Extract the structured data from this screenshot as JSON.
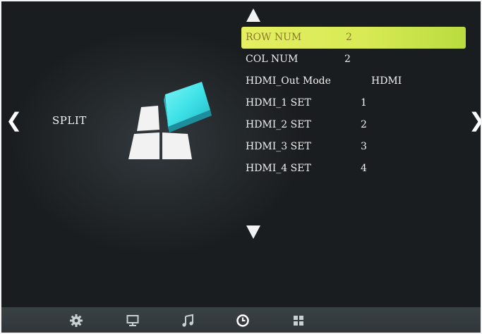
{
  "navigation": {
    "prev_arrow": "❮",
    "next_arrow": "❯"
  },
  "category": {
    "label": "SPLIT",
    "icon": "split-screen-icon"
  },
  "menu": {
    "items": [
      {
        "label": "ROW NUM",
        "value": "2",
        "selected": true
      },
      {
        "label": "COL NUM",
        "value": "2",
        "selected": false
      },
      {
        "label": "HDMI_Out Mode",
        "value": "HDMI",
        "selected": false
      },
      {
        "label": "HDMI_1 SET",
        "value": "1",
        "selected": false
      },
      {
        "label": "HDMI_2 SET",
        "value": "2",
        "selected": false
      },
      {
        "label": "HDMI_3 SET",
        "value": "3",
        "selected": false
      },
      {
        "label": "HDMI_4 SET",
        "value": "4",
        "selected": false
      }
    ],
    "scroll_up_icon": "triangle-up-icon",
    "scroll_down_icon": "triangle-down-icon"
  },
  "bottom_bar": {
    "icons": [
      "gear-icon",
      "monitor-icon",
      "music-icon",
      "clock-icon",
      "grid-icon"
    ],
    "active": "clock-icon"
  },
  "colors": {
    "highlight": "#d8ea55",
    "highlight_text": "#8a7a2c",
    "background": "#1a1d20",
    "bar": "#343b3f",
    "accent_cyan": "#3fe3e8"
  }
}
